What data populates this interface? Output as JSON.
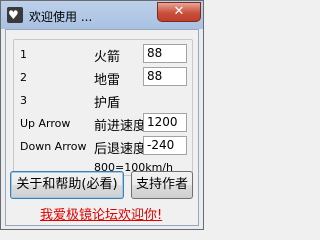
{
  "window": {
    "title": "欢迎使用 ...",
    "icon_glyph": "♥",
    "close_glyph": "✕"
  },
  "rows": [
    {
      "key": "1",
      "name": "火箭",
      "value": "88"
    },
    {
      "key": "2",
      "name": "地雷",
      "value": "88"
    },
    {
      "key": "3",
      "name": "护盾"
    },
    {
      "key": "Up Arrow",
      "name": "前进速度",
      "value": "1200"
    },
    {
      "key": "Down Arrow",
      "name": "后退速度",
      "value": "-240"
    }
  ],
  "note": "800=100km/h",
  "buttons": {
    "about": "关于和帮助(必看)",
    "support": "支持作者"
  },
  "link": "我爱极镜论坛欢迎你!",
  "colors": {
    "link": "#e00000",
    "titlebar": "#a9c1e2",
    "close": "#c8503b"
  }
}
